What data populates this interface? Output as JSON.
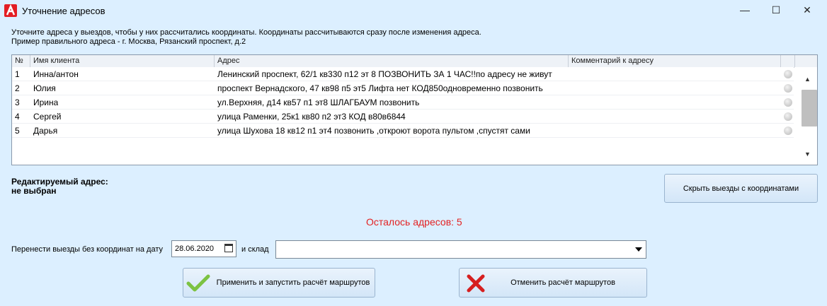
{
  "window": {
    "title": "Уточнение адресов",
    "minimize": "—",
    "maximize": "☐",
    "close": "✕"
  },
  "instructions": {
    "line1": "Уточните адреса у выездов, чтобы у них рассчитались координаты. Координаты рассчитываются сразу после изменения адреса.",
    "line2": "Пример правильного адреса - г. Москва, Рязанский проспект, д.2"
  },
  "table": {
    "headers": {
      "num": "№",
      "client": "Имя клиента",
      "address": "Адрес",
      "comment": "Комментарий к адресу"
    },
    "rows": [
      {
        "num": "1",
        "client": "Инна/антон",
        "address": "Ленинский проспект, 62/1 кв330 п12 эт 8 ПОЗВОНИТЬ ЗА 1 ЧАС!!по адресу не живут",
        "comment": ""
      },
      {
        "num": "2",
        "client": "Юлия",
        "address": "проспект Вернадского, 47 кв98 п5 эт5 Лифта нет КОД850одновременно позвонить",
        "comment": ""
      },
      {
        "num": "3",
        "client": "Ирина",
        "address": "ул.Верхняя, д14 кв57 п1 эт8 ШЛАГБАУМ позвонить",
        "comment": ""
      },
      {
        "num": "4",
        "client": "Сергей",
        "address": "улица Раменки, 25к1 кв80 п2 эт3 КОД в80в6844",
        "comment": ""
      },
      {
        "num": "5",
        "client": "Дарья",
        "address": "улица Шухова 18 кв12 п1 эт4 позвонить ,откроют ворота пультом ,спустят сами",
        "comment": ""
      }
    ]
  },
  "edit": {
    "line1": "Редактируемый адрес:",
    "line2": "не выбран"
  },
  "hide_button": "Скрыть выезды с координатами",
  "remaining": "Осталось адресов: 5",
  "transfer": {
    "label": "Перенести выезды без координат на дату",
    "date": "28.06.2020",
    "warehouse_label": "и склад",
    "warehouse_value": ""
  },
  "apply_button": "Применить и запустить расчёт маршрутов",
  "cancel_button": "Отменить расчёт маршрутов",
  "colors": {
    "background": "#dcefff",
    "remaining_text": "#e32222",
    "brand": "#e31e24",
    "check": "#7cc242",
    "cross": "#d61f1f"
  }
}
